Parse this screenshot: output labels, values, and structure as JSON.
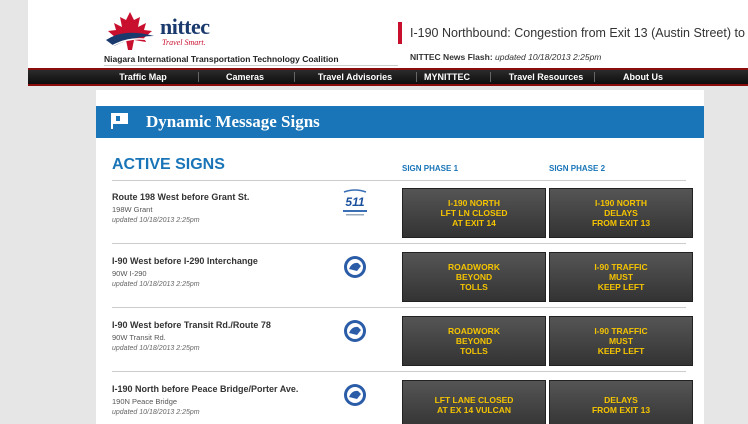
{
  "header": {
    "brand": "nittec",
    "tagline": "Travel Smart.",
    "org_name": "Niagara International Transportation Technology Coalition",
    "ticker": "I-190 Northbound: Congestion from Exit 13 (Austin Street) to",
    "news_label": "NITTEC News Flash:",
    "news_updated": "updated 10/18/2013 2:25pm",
    "colors": {
      "brand_blue": "#1a3a6e",
      "accent_red": "#c8102e"
    }
  },
  "nav": {
    "items": [
      {
        "label": "Traffic Map"
      },
      {
        "label": "Cameras"
      },
      {
        "label": "Travel Advisories"
      },
      {
        "label": "MYNITTEC"
      },
      {
        "label": "Travel Resources"
      },
      {
        "label": "About Us"
      }
    ]
  },
  "page": {
    "title": "Dynamic Message Signs",
    "title_icon": "flag-icon",
    "active_signs_heading": "ACTIVE SIGNS",
    "phase1_heading": "SIGN PHASE 1",
    "phase2_heading": "SIGN PHASE 2",
    "colors": {
      "banner_blue": "#1975b7",
      "sign_text": "#f5c400"
    }
  },
  "signs": [
    {
      "name": "Route 198 West before Grant St.",
      "code": "198W Grant",
      "updated": "updated 10/18/2013 2:25pm",
      "badge_icon": "511-logo-icon",
      "phase1": [
        "I-190 NORTH",
        "LFT LN CLOSED",
        "AT EXIT 14"
      ],
      "phase2": [
        "I-190 NORTH",
        "DELAYS",
        "FROM EXIT 13"
      ]
    },
    {
      "name": "I-90 West before I-290 Interchange",
      "code": "90W I-290",
      "updated": "updated 10/18/2013 2:25pm",
      "badge_icon": "nys-seal-icon",
      "phase1": [
        "ROADWORK",
        "BEYOND",
        "TOLLS"
      ],
      "phase2": [
        "I-90 TRAFFIC",
        "MUST",
        "KEEP LEFT"
      ]
    },
    {
      "name": "I-90 West before Transit Rd./Route 78",
      "code": "90W Transit Rd.",
      "updated": "updated 10/18/2013 2:25pm",
      "badge_icon": "nys-seal-icon",
      "phase1": [
        "ROADWORK",
        "BEYOND",
        "TOLLS"
      ],
      "phase2": [
        "I-90 TRAFFIC",
        "MUST",
        "KEEP LEFT"
      ]
    },
    {
      "name": "I-190 North before Peace Bridge/Porter Ave.",
      "code": "190N Peace Bridge",
      "updated": "updated 10/18/2013 2:25pm",
      "badge_icon": "nys-seal-icon",
      "phase1": [
        "LFT LANE CLOSED",
        "AT EX 14 VULCAN"
      ],
      "phase2": [
        "DELAYS",
        "FROM EXIT 13"
      ]
    }
  ]
}
